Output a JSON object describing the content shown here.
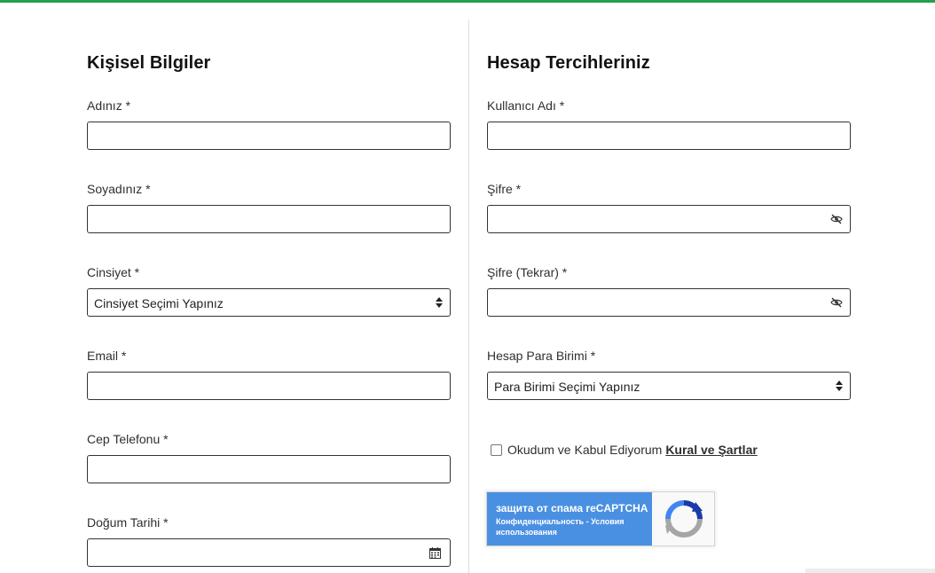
{
  "colors": {
    "accent_bar": "#22a04b",
    "recaptcha_blue": "#4a90e2"
  },
  "personal": {
    "title": "Kişisel Bilgiler",
    "first_name_label": "Adınız *",
    "first_name_value": "",
    "last_name_label": "Soyadınız *",
    "last_name_value": "",
    "gender_label": "Cinsiyet *",
    "gender_selected": "Cinsiyet Seçimi Yapınız",
    "email_label": "Email *",
    "email_value": "",
    "phone_label": "Cep Telefonu *",
    "phone_value": "",
    "birth_label": "Doğum Tarihi *",
    "birth_value": "",
    "birth_icon": "calendar-icon"
  },
  "account": {
    "title": "Hesap Tercihleriniz",
    "username_label": "Kullanıcı Adı *",
    "username_value": "",
    "password_label": "Şifre *",
    "password_value": "",
    "password_repeat_label": "Şifre (Tekrar) *",
    "password_repeat_value": "",
    "password_icon": "eye-slash-icon",
    "currency_label": "Hesap Para Birimi *",
    "currency_selected": "Para Birimi Seçimi Yapınız"
  },
  "agreement": {
    "checked": false,
    "text": "Okudum ve Kabul Ediyorum",
    "link": "Kural ve Şartlar"
  },
  "recaptcha": {
    "title": "защита от спама reCAPTCHA",
    "links": "Конфиденциальность - Условия использования",
    "logo_icon": "recaptcha-logo-icon"
  }
}
